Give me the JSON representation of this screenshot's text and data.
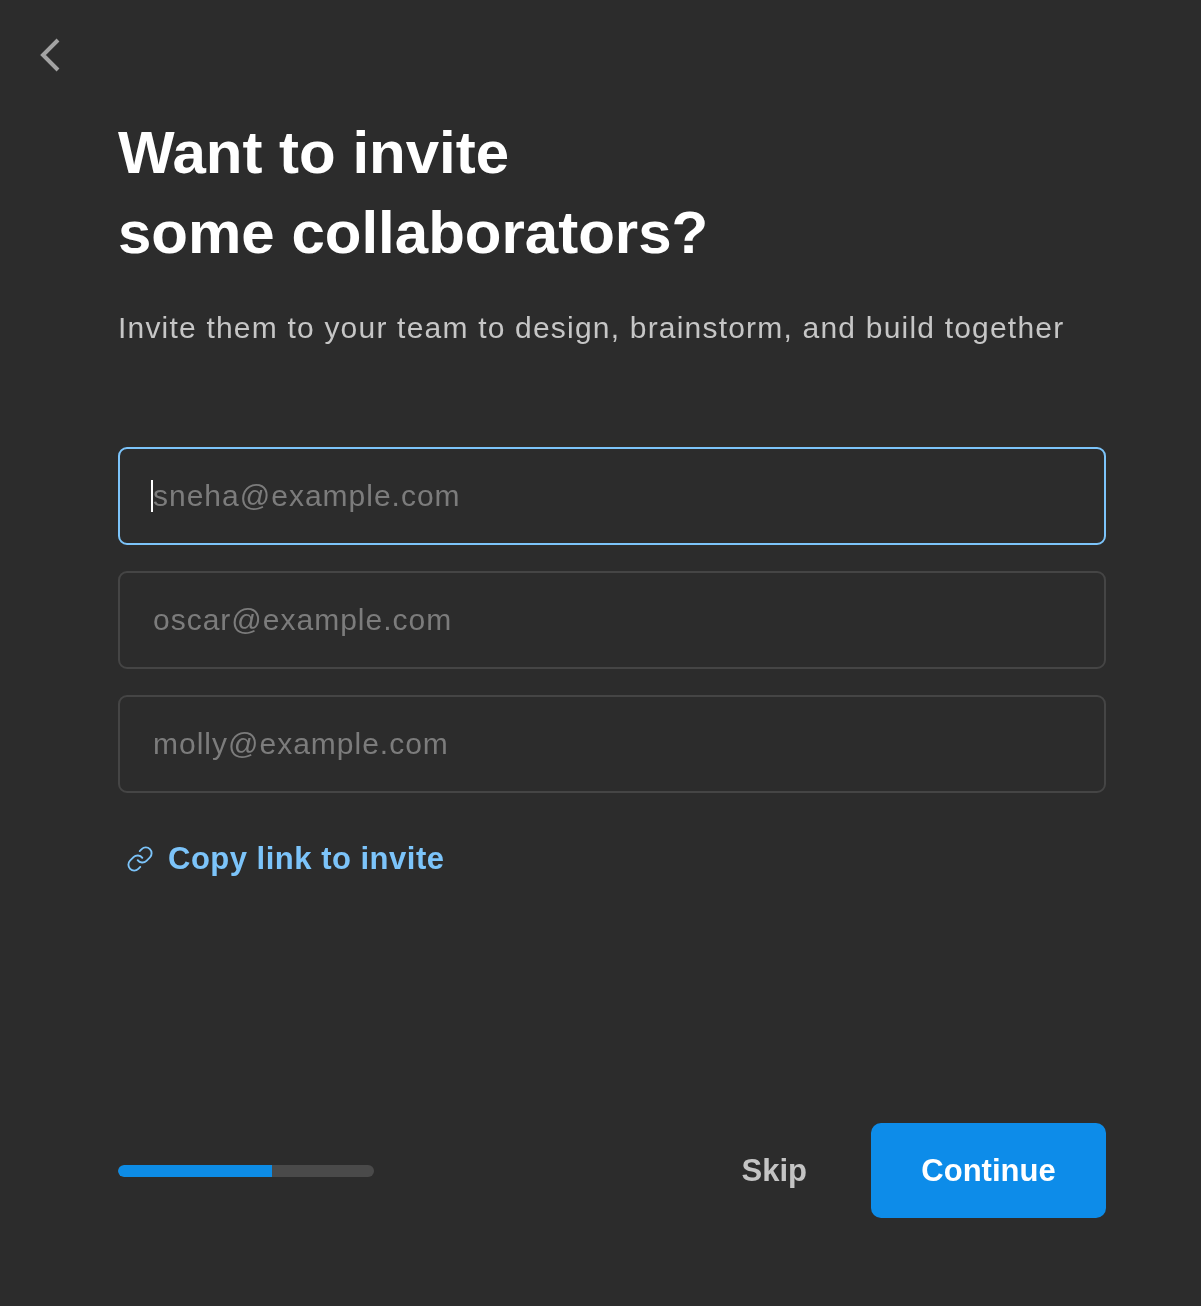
{
  "title_lines": [
    "Want to invite",
    "some collaborators?"
  ],
  "subtitle": "Invite them to your team to design, brainstorm, and build together",
  "invite_fields": [
    {
      "placeholder": "sneha@example.com",
      "focused": true
    },
    {
      "placeholder": "oscar@example.com",
      "focused": false
    },
    {
      "placeholder": "molly@example.com",
      "focused": false
    }
  ],
  "copy_link": {
    "label": "Copy link to invite"
  },
  "footer": {
    "progress": {
      "level": 0.6
    },
    "skip_button": "Skip",
    "continue_button": "Continue"
  }
}
